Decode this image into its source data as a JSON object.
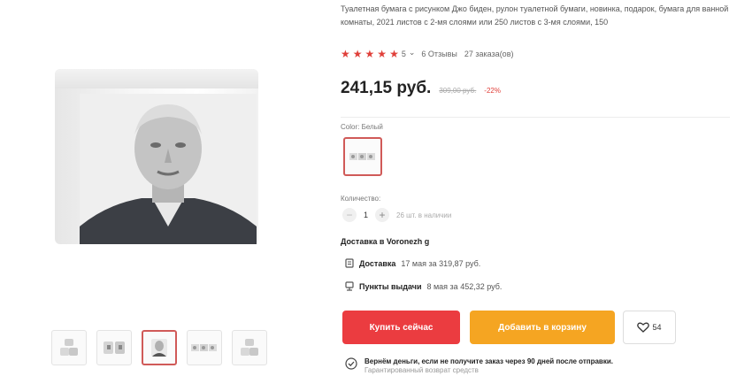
{
  "product": {
    "title": "Туалетная бумага с рисунком Джо биден, рулон туалетной бумаги, новинка, подарок, бумага для ванной комнаты, 2021 листов с 2-мя слоями или 250 листов с 3-мя слоями, 150",
    "rating": "5",
    "rating_chevron": "⌄",
    "reviews": "6 Отзывы",
    "orders": "27 заказа(ов)",
    "price": "241,15 руб.",
    "old_price": "309,00 руб.",
    "discount": "-22%"
  },
  "colors": {
    "accent_red": "#eb3c40",
    "accent_orange": "#f5a522",
    "star": "#e0403a"
  },
  "color_option": {
    "label": "Color: Белый"
  },
  "quantity": {
    "label": "Количество:",
    "value": "1",
    "minus": "−",
    "plus": "+",
    "stock": "26 шт. в наличии"
  },
  "delivery": {
    "title": "Доставка в Voronezh g",
    "line1_label": "Доставка",
    "line1_text": "17 мая за 319,87 руб.",
    "line2_label": "Пункты выдачи",
    "line2_text": "8 мая за 452,32 руб."
  },
  "actions": {
    "buy": "Купить сейчас",
    "cart": "Добавить в корзину",
    "wishlist_count": "54"
  },
  "guarantee": {
    "main": "Вернём деньги, если не получите заказ через 90 дней после отправки.",
    "sub": "Гарантированный возврат средств"
  },
  "gallery": {
    "active_thumb": 3,
    "thumbs": [
      "thumb-rolls-stack",
      "thumb-rolls-pair",
      "thumb-roll-portrait",
      "thumb-sheets-strip",
      "thumb-rolls-stack-2"
    ]
  }
}
